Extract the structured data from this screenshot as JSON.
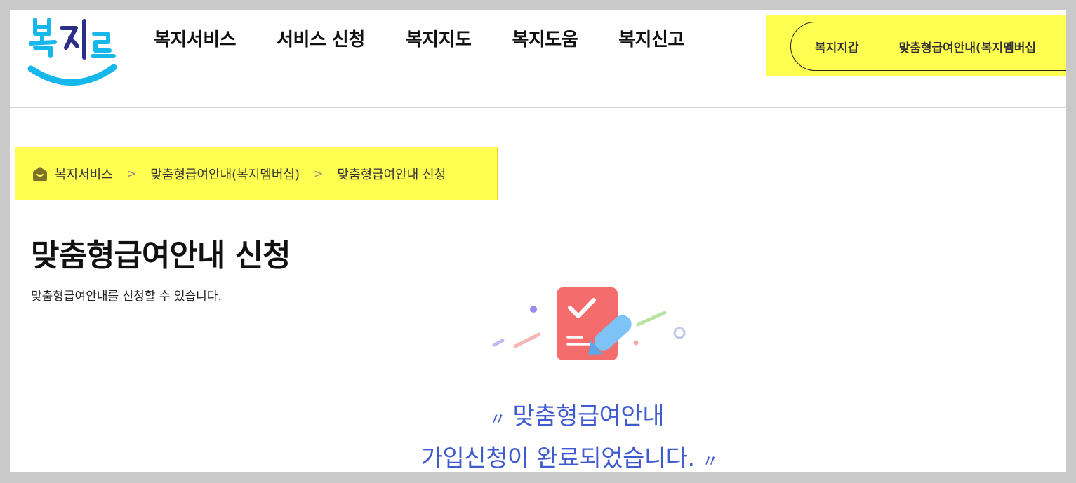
{
  "header": {
    "nav": [
      {
        "label": "복지서비스"
      },
      {
        "label": "서비스 신청"
      },
      {
        "label": "복지지도"
      },
      {
        "label": "복지도움"
      },
      {
        "label": "복지신고"
      }
    ],
    "util_links": [
      {
        "label": "복지지갑"
      },
      {
        "label": "맞춤형급여안내(복지멤버십"
      }
    ]
  },
  "breadcrumb": {
    "items": [
      {
        "label": "복지서비스"
      },
      {
        "label": "맞춤형급여안내(복지멤버십)"
      },
      {
        "label": "맞춤형급여안내 신청"
      }
    ],
    "separator": ">"
  },
  "page": {
    "title": "맞춤형급여안내 신청",
    "description": "맞춤형급여안내를 신청할 수 있습니다."
  },
  "completion": {
    "open_quote": "〃",
    "close_quote": "〃",
    "line1": "맞춤형급여안내",
    "line2": "가입신청이 완료되었습니다."
  },
  "colors": {
    "highlight": "#ffff52",
    "message_blue": "#3f5bd0",
    "logo_blue": "#16b8ec",
    "card_red": "#f56c6c"
  },
  "icons": {
    "logo": "bokjiro-logo",
    "home": "home-icon",
    "illustration": "application-complete-illustration"
  }
}
